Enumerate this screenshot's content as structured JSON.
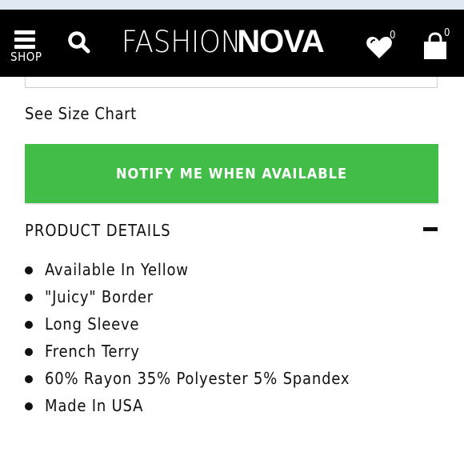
{
  "header": {
    "shop_label": "SHOP",
    "logo_light": "FASHION",
    "logo_bold": "NOVA",
    "wishlist_count": "0",
    "cart_count": "0",
    "icons": [
      "menu-icon",
      "search-icon",
      "heart-icon",
      "bag-icon"
    ]
  },
  "product": {
    "size_chart_link": "See Size Chart",
    "notify_button": "NOTIFY ME WHEN AVAILABLE",
    "notify_color": "#42bd48",
    "details_title": "PRODUCT DETAILS",
    "details": [
      "Available In Yellow",
      "\"Juicy\" Border",
      "Long Sleeve",
      "French Terry",
      "60% Rayon 35% Polyester 5% Spandex",
      "Made In USA"
    ]
  }
}
